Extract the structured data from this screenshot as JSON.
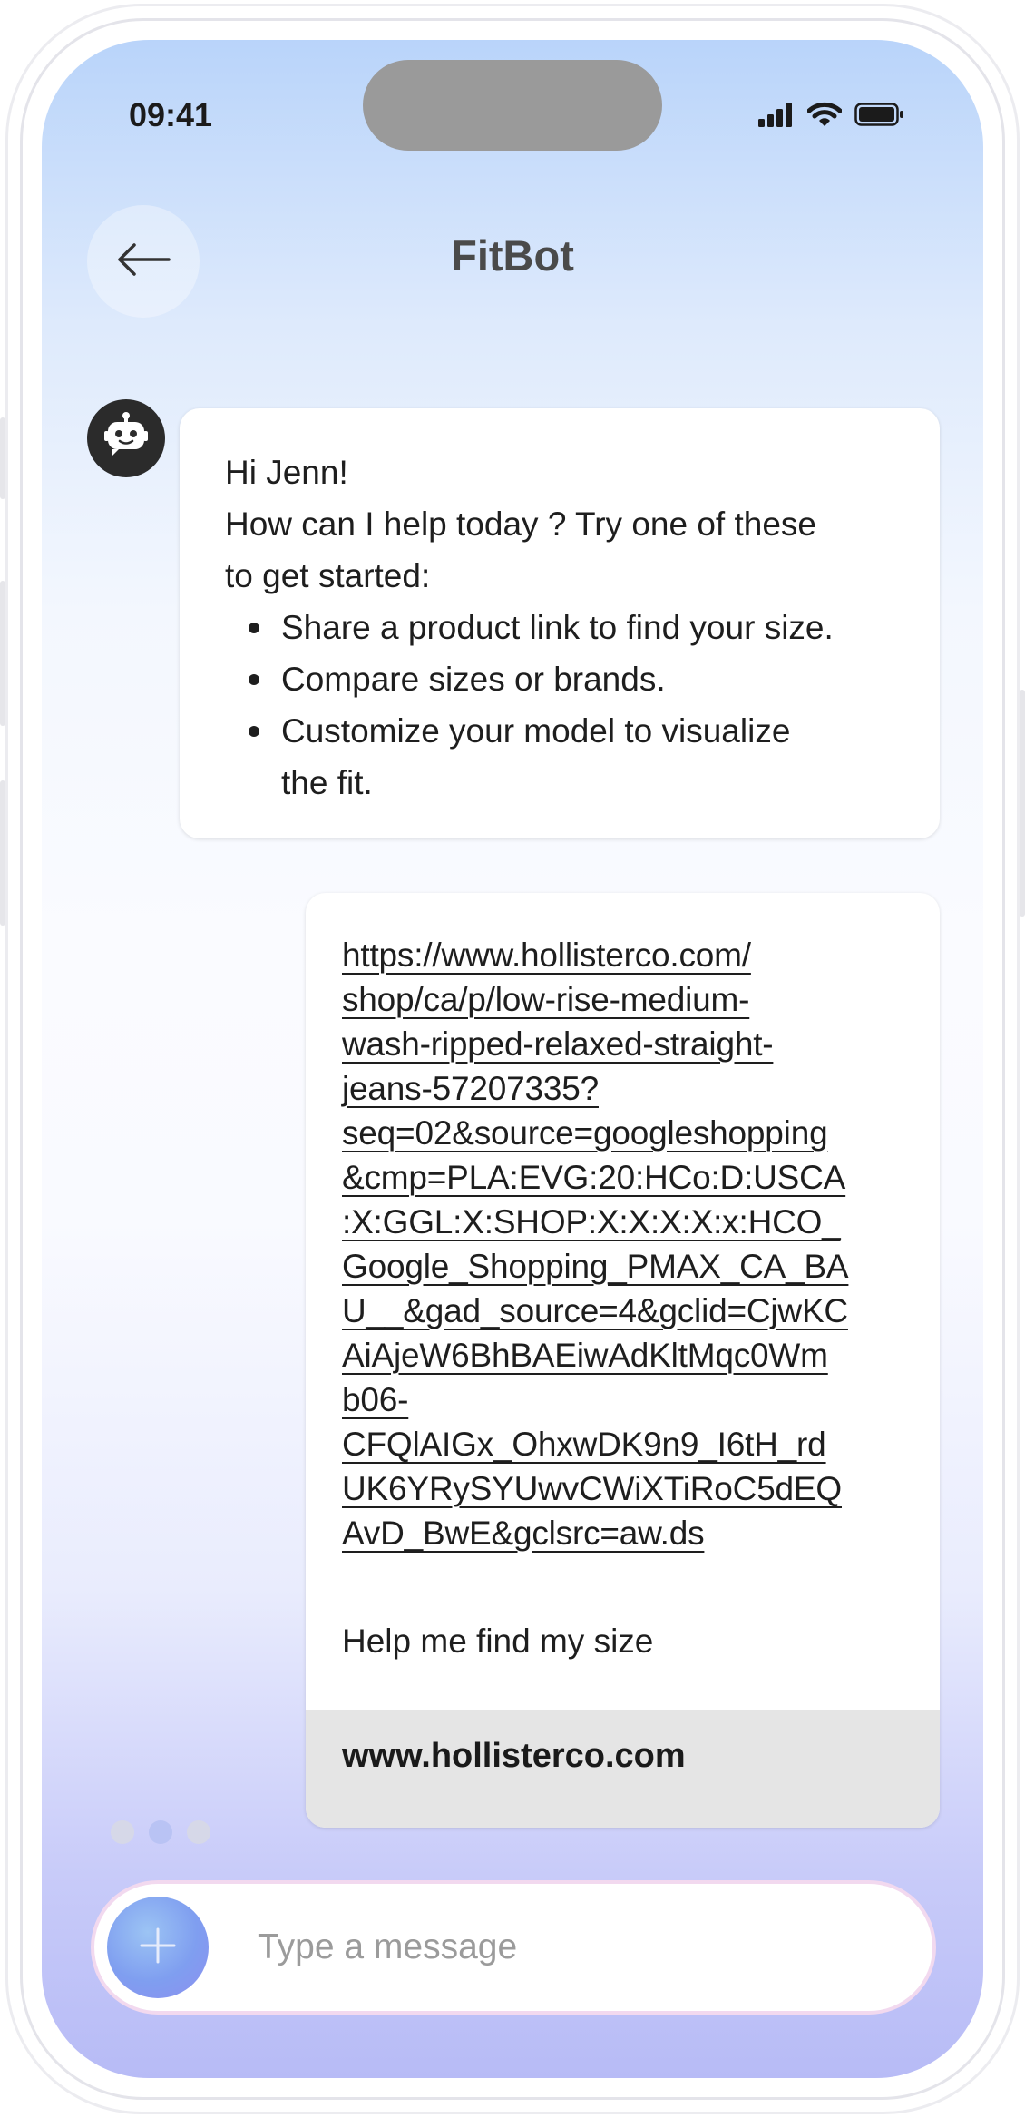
{
  "status_bar": {
    "time": "09:41"
  },
  "header": {
    "title": "FitBot"
  },
  "bot_message": {
    "greeting": "Hi Jenn!",
    "line1": "How can I help today ? Try one of these",
    "line2": "to get started:",
    "options": [
      "Share a product link to find your size.",
      "Compare sizes or brands.",
      "Customize your model to visualize"
    ],
    "option3_cont": "the fit."
  },
  "user_message": {
    "link_lines": [
      "https://www.hollisterco.com/",
      "shop/ca/p/low-rise-medium-",
      "wash-ripped-relaxed-straight-",
      "jeans-57207335?",
      "seq=02&source=googleshopping",
      "&cmp=PLA:EVG:20:HCo:D:USCA",
      ":X:GGL:X:SHOP:X:X:X:X:x:HCO_",
      "Google_Shopping_PMAX_CA_BA",
      "U__&gad_source=4&gclid=CjwKC",
      "AiAjeW6BhBAEiwAdKltMqc0Wm",
      "b06-",
      "CFQlAIGx_OhxwDK9n9_I6tH_rd",
      "UK6YRySYUwvCWiXTiRoC5dEQ",
      "AvD_BwE&gclsrc=aw.ds"
    ],
    "text": "Help me find my size",
    "preview_domain": "www.hollisterco.com"
  },
  "input": {
    "placeholder": "Type a message"
  },
  "colors": {
    "accent_gradient_top": "#b9d4fa",
    "accent_gradient_bottom": "#b7bbf6",
    "bot_avatar_bg": "#2b2b2b",
    "preview_bar_bg": "#e5e5e5"
  },
  "icons": {
    "back": "arrow-left-icon",
    "bot": "robot-icon",
    "plus": "plus-icon",
    "signal": "cellular-signal-icon",
    "wifi": "wifi-icon",
    "battery": "battery-icon"
  }
}
